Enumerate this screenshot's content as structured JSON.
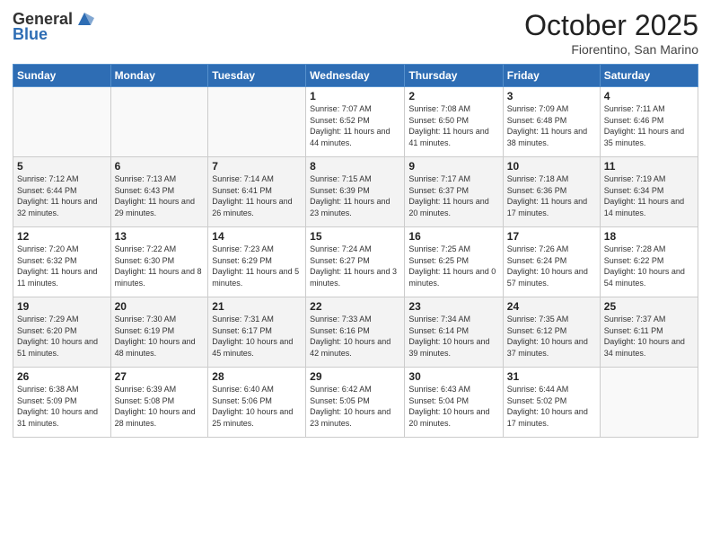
{
  "header": {
    "logo_general": "General",
    "logo_blue": "Blue",
    "month": "October 2025",
    "location": "Fiorentino, San Marino"
  },
  "days_of_week": [
    "Sunday",
    "Monday",
    "Tuesday",
    "Wednesday",
    "Thursday",
    "Friday",
    "Saturday"
  ],
  "weeks": [
    [
      {
        "day": "",
        "sunrise": "",
        "sunset": "",
        "daylight": ""
      },
      {
        "day": "",
        "sunrise": "",
        "sunset": "",
        "daylight": ""
      },
      {
        "day": "",
        "sunrise": "",
        "sunset": "",
        "daylight": ""
      },
      {
        "day": "1",
        "sunrise": "Sunrise: 7:07 AM",
        "sunset": "Sunset: 6:52 PM",
        "daylight": "Daylight: 11 hours and 44 minutes."
      },
      {
        "day": "2",
        "sunrise": "Sunrise: 7:08 AM",
        "sunset": "Sunset: 6:50 PM",
        "daylight": "Daylight: 11 hours and 41 minutes."
      },
      {
        "day": "3",
        "sunrise": "Sunrise: 7:09 AM",
        "sunset": "Sunset: 6:48 PM",
        "daylight": "Daylight: 11 hours and 38 minutes."
      },
      {
        "day": "4",
        "sunrise": "Sunrise: 7:11 AM",
        "sunset": "Sunset: 6:46 PM",
        "daylight": "Daylight: 11 hours and 35 minutes."
      }
    ],
    [
      {
        "day": "5",
        "sunrise": "Sunrise: 7:12 AM",
        "sunset": "Sunset: 6:44 PM",
        "daylight": "Daylight: 11 hours and 32 minutes."
      },
      {
        "day": "6",
        "sunrise": "Sunrise: 7:13 AM",
        "sunset": "Sunset: 6:43 PM",
        "daylight": "Daylight: 11 hours and 29 minutes."
      },
      {
        "day": "7",
        "sunrise": "Sunrise: 7:14 AM",
        "sunset": "Sunset: 6:41 PM",
        "daylight": "Daylight: 11 hours and 26 minutes."
      },
      {
        "day": "8",
        "sunrise": "Sunrise: 7:15 AM",
        "sunset": "Sunset: 6:39 PM",
        "daylight": "Daylight: 11 hours and 23 minutes."
      },
      {
        "day": "9",
        "sunrise": "Sunrise: 7:17 AM",
        "sunset": "Sunset: 6:37 PM",
        "daylight": "Daylight: 11 hours and 20 minutes."
      },
      {
        "day": "10",
        "sunrise": "Sunrise: 7:18 AM",
        "sunset": "Sunset: 6:36 PM",
        "daylight": "Daylight: 11 hours and 17 minutes."
      },
      {
        "day": "11",
        "sunrise": "Sunrise: 7:19 AM",
        "sunset": "Sunset: 6:34 PM",
        "daylight": "Daylight: 11 hours and 14 minutes."
      }
    ],
    [
      {
        "day": "12",
        "sunrise": "Sunrise: 7:20 AM",
        "sunset": "Sunset: 6:32 PM",
        "daylight": "Daylight: 11 hours and 11 minutes."
      },
      {
        "day": "13",
        "sunrise": "Sunrise: 7:22 AM",
        "sunset": "Sunset: 6:30 PM",
        "daylight": "Daylight: 11 hours and 8 minutes."
      },
      {
        "day": "14",
        "sunrise": "Sunrise: 7:23 AM",
        "sunset": "Sunset: 6:29 PM",
        "daylight": "Daylight: 11 hours and 5 minutes."
      },
      {
        "day": "15",
        "sunrise": "Sunrise: 7:24 AM",
        "sunset": "Sunset: 6:27 PM",
        "daylight": "Daylight: 11 hours and 3 minutes."
      },
      {
        "day": "16",
        "sunrise": "Sunrise: 7:25 AM",
        "sunset": "Sunset: 6:25 PM",
        "daylight": "Daylight: 11 hours and 0 minutes."
      },
      {
        "day": "17",
        "sunrise": "Sunrise: 7:26 AM",
        "sunset": "Sunset: 6:24 PM",
        "daylight": "Daylight: 10 hours and 57 minutes."
      },
      {
        "day": "18",
        "sunrise": "Sunrise: 7:28 AM",
        "sunset": "Sunset: 6:22 PM",
        "daylight": "Daylight: 10 hours and 54 minutes."
      }
    ],
    [
      {
        "day": "19",
        "sunrise": "Sunrise: 7:29 AM",
        "sunset": "Sunset: 6:20 PM",
        "daylight": "Daylight: 10 hours and 51 minutes."
      },
      {
        "day": "20",
        "sunrise": "Sunrise: 7:30 AM",
        "sunset": "Sunset: 6:19 PM",
        "daylight": "Daylight: 10 hours and 48 minutes."
      },
      {
        "day": "21",
        "sunrise": "Sunrise: 7:31 AM",
        "sunset": "Sunset: 6:17 PM",
        "daylight": "Daylight: 10 hours and 45 minutes."
      },
      {
        "day": "22",
        "sunrise": "Sunrise: 7:33 AM",
        "sunset": "Sunset: 6:16 PM",
        "daylight": "Daylight: 10 hours and 42 minutes."
      },
      {
        "day": "23",
        "sunrise": "Sunrise: 7:34 AM",
        "sunset": "Sunset: 6:14 PM",
        "daylight": "Daylight: 10 hours and 39 minutes."
      },
      {
        "day": "24",
        "sunrise": "Sunrise: 7:35 AM",
        "sunset": "Sunset: 6:12 PM",
        "daylight": "Daylight: 10 hours and 37 minutes."
      },
      {
        "day": "25",
        "sunrise": "Sunrise: 7:37 AM",
        "sunset": "Sunset: 6:11 PM",
        "daylight": "Daylight: 10 hours and 34 minutes."
      }
    ],
    [
      {
        "day": "26",
        "sunrise": "Sunrise: 6:38 AM",
        "sunset": "Sunset: 5:09 PM",
        "daylight": "Daylight: 10 hours and 31 minutes."
      },
      {
        "day": "27",
        "sunrise": "Sunrise: 6:39 AM",
        "sunset": "Sunset: 5:08 PM",
        "daylight": "Daylight: 10 hours and 28 minutes."
      },
      {
        "day": "28",
        "sunrise": "Sunrise: 6:40 AM",
        "sunset": "Sunset: 5:06 PM",
        "daylight": "Daylight: 10 hours and 25 minutes."
      },
      {
        "day": "29",
        "sunrise": "Sunrise: 6:42 AM",
        "sunset": "Sunset: 5:05 PM",
        "daylight": "Daylight: 10 hours and 23 minutes."
      },
      {
        "day": "30",
        "sunrise": "Sunrise: 6:43 AM",
        "sunset": "Sunset: 5:04 PM",
        "daylight": "Daylight: 10 hours and 20 minutes."
      },
      {
        "day": "31",
        "sunrise": "Sunrise: 6:44 AM",
        "sunset": "Sunset: 5:02 PM",
        "daylight": "Daylight: 10 hours and 17 minutes."
      },
      {
        "day": "",
        "sunrise": "",
        "sunset": "",
        "daylight": ""
      }
    ]
  ]
}
